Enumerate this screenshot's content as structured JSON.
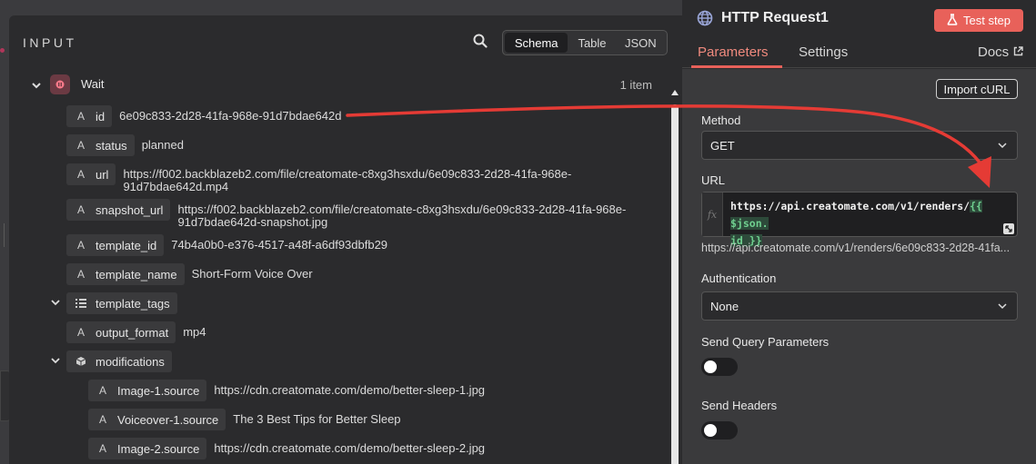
{
  "input_panel": {
    "title": "INPUT",
    "view_tabs": [
      "Schema",
      "Table",
      "JSON"
    ],
    "active_view": "Schema",
    "root": {
      "label": "Wait",
      "count": "1 item"
    },
    "fields": [
      {
        "name": "id",
        "type_icon": "A",
        "value": "6e09c833-2d28-41fa-968e-91d7bdae642d"
      },
      {
        "name": "status",
        "type_icon": "A",
        "value": "planned"
      },
      {
        "name": "url",
        "type_icon": "A",
        "value": "https://f002.backblazeb2.com/file/creatomate-c8xg3hsxdu/6e09c833-2d28-41fa-968e-\n91d7bdae642d.mp4"
      },
      {
        "name": "snapshot_url",
        "type_icon": "A",
        "value": "https://f002.backblazeb2.com/file/creatomate-c8xg3hsxdu/6e09c833-2d28-41fa-968e-\n91d7bdae642d-snapshot.jpg"
      },
      {
        "name": "template_id",
        "type_icon": "A",
        "value": "74b4a0b0-e376-4517-a48f-a6df93dbfb29"
      },
      {
        "name": "template_name",
        "type_icon": "A",
        "value": "Short-Form Voice Over"
      },
      {
        "name": "template_tags",
        "type_icon": "list-icon",
        "value": ""
      },
      {
        "name": "output_format",
        "type_icon": "A",
        "value": "mp4"
      },
      {
        "name": "modifications",
        "type_icon": "cube-icon",
        "value": ""
      },
      {
        "name": "Image-1.source",
        "type_icon": "A",
        "value": "https://cdn.creatomate.com/demo/better-sleep-1.jpg"
      },
      {
        "name": "Voiceover-1.source",
        "type_icon": "A",
        "value": "The 3 Best Tips for Better Sleep"
      },
      {
        "name": "Image-2.source",
        "type_icon": "A",
        "value": "https://cdn.creatomate.com/demo/better-sleep-2.jpg"
      }
    ]
  },
  "node_panel": {
    "title": "HTTP Request1",
    "test_button": "Test step",
    "tabs": [
      "Parameters",
      "Settings"
    ],
    "active_tab": "Parameters",
    "docs_label": "Docs",
    "import_curl": "Import cURL",
    "method_label": "Method",
    "method_value": "GET",
    "url_label": "URL",
    "url_fx": "fx",
    "url_static": "https://api.creatomate.com/v1/renders/",
    "url_expression_1": "{{ $json.",
    "url_expression_2": "id }}",
    "url_preview": "https://api.creatomate.com/v1/renders/6e09c833-2d28-41fa...",
    "auth_label": "Authentication",
    "auth_value": "None",
    "query_label": "Send Query Parameters",
    "query_enabled": false,
    "headers_label": "Send Headers",
    "headers_enabled": false
  },
  "colors": {
    "accent": "#e8615a",
    "arrow": "#e53b35",
    "expression": "#6fcf8f"
  }
}
